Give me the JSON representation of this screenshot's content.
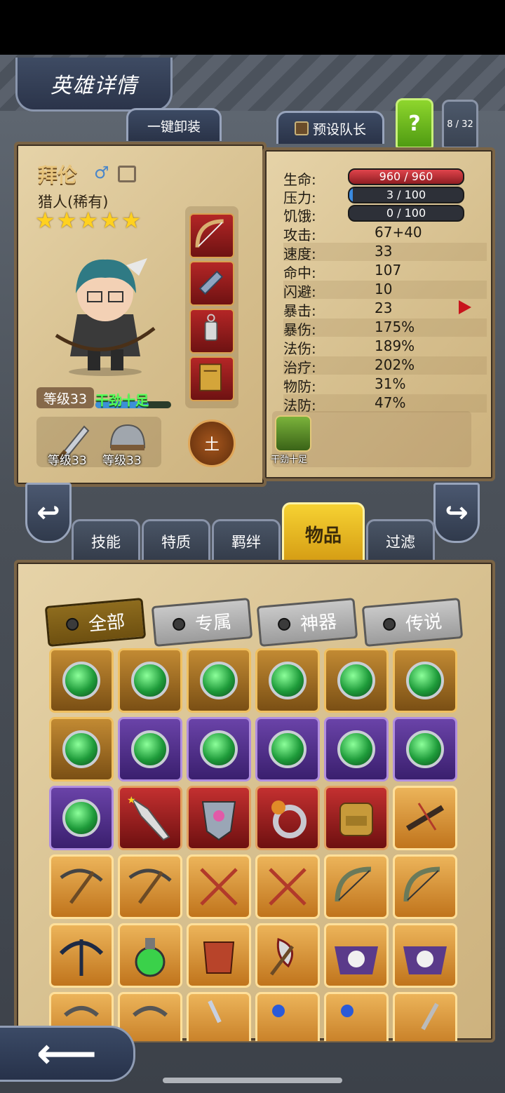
{
  "header": {
    "title": "英雄详情",
    "unequip_all": "一键卸装",
    "preset_captain": "预设队长",
    "help": "?",
    "hero_count": "8 / 32"
  },
  "hero": {
    "name": "拜伦",
    "gender_icon": "male-icon",
    "class": "猎人(稀有)",
    "stars": 5,
    "level": "等级33",
    "mood": "干劲十足",
    "weapon_level": "等级33",
    "armor_level": "等级33",
    "element": "土"
  },
  "stats": {
    "hp_label": "生命:",
    "hp": "960 / 960",
    "stress_label": "压力:",
    "stress": "3 / 100",
    "stress_fraction": 0.03,
    "hunger_label": "饥饿:",
    "hunger": "0 / 100",
    "rows": [
      {
        "k": "攻击:",
        "v": "67+40"
      },
      {
        "k": "速度:",
        "v": "33"
      },
      {
        "k": "命中:",
        "v": "107"
      },
      {
        "k": "闪避:",
        "v": "10"
      },
      {
        "k": "暴击:",
        "v": "23"
      },
      {
        "k": "暴伤:",
        "v": "175%"
      },
      {
        "k": "法伤:",
        "v": "189%"
      },
      {
        "k": "治疗:",
        "v": "202%"
      },
      {
        "k": "物防:",
        "v": "31%"
      },
      {
        "k": "法防:",
        "v": "47%"
      }
    ],
    "trait": "干劲十足"
  },
  "tabs": [
    "技能",
    "特质",
    "羁绊",
    "物品",
    "过滤"
  ],
  "active_tab": "物品",
  "filters": [
    "全部",
    "专属",
    "神器",
    "传说"
  ],
  "colors": {
    "gold": "#f6d232",
    "hp_red": "#e0444c",
    "stress_blue": "#3a8ae0",
    "mood_green": "#53ff57"
  }
}
